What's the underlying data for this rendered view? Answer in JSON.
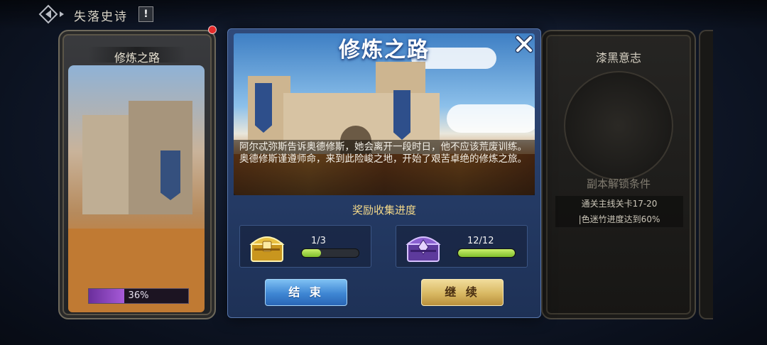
{
  "topbar": {
    "title": "失落史诗",
    "info_icon_label": "!"
  },
  "left_card": {
    "title": "修炼之路",
    "progress_label": "36%",
    "progress_value": 0.36
  },
  "right_card": {
    "title": "漆黑意志",
    "unlock_title": "副本解锁条件",
    "requirements": [
      "通关主线关卡17-20",
      "|色迷竹进度达到60%"
    ]
  },
  "modal": {
    "title": "修炼之路",
    "story_lines": [
      "阿尔忒弥斯告诉奥德修斯，她会离开一段时日，他不应该荒废训练。",
      "奥德修斯谨遵师命，来到此险峻之地，开始了艰苦卓绝的修炼之旅。"
    ],
    "reward_title": "奖励收集进度",
    "rewards": [
      {
        "icon": "gold-chest-icon",
        "count_label": "1/3",
        "progress": 0.333
      },
      {
        "icon": "purple-chest-icon",
        "count_label": "12/12",
        "progress": 1.0
      }
    ],
    "buttons": {
      "end_label": "结 束",
      "continue_label": "继 续"
    }
  },
  "colors": {
    "accent_blue": "#3e86d3",
    "accent_gold": "#d8b862",
    "progress_green": "#9bd640",
    "progress_purple": "#a65ad8"
  }
}
